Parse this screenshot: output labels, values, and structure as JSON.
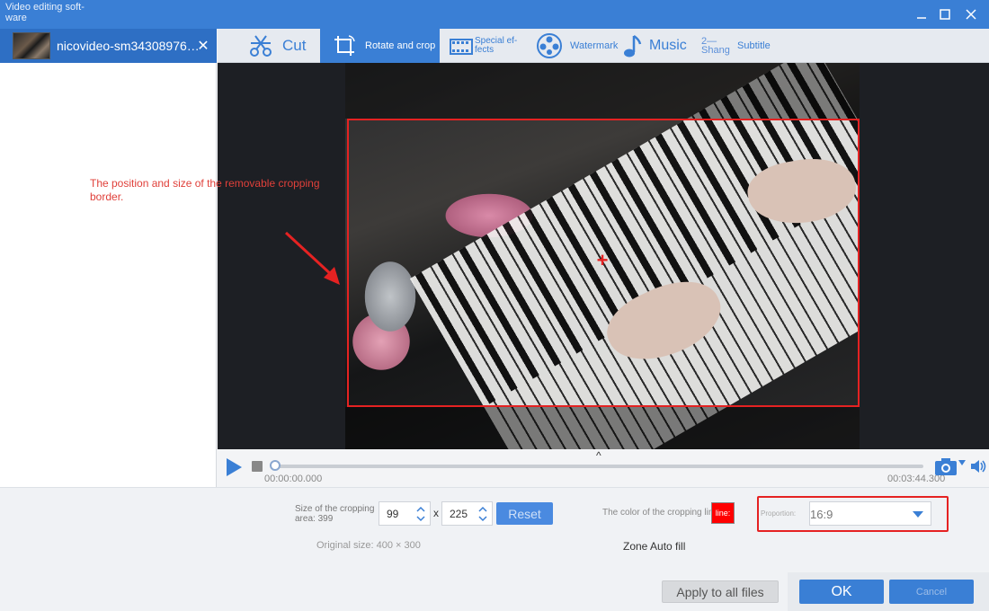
{
  "window": {
    "title": "Video editing soft-ware"
  },
  "file_list": {
    "items": [
      {
        "name": "nicovideo-sm34308976_9..."
      }
    ]
  },
  "toolbar": {
    "tabs": [
      {
        "label": "Cut",
        "icon": "scissors-icon",
        "active": false
      },
      {
        "label": "Rotate and crop",
        "icon": "crop-icon",
        "active": true
      },
      {
        "label": "Special ef-fects",
        "icon": "film-effects-icon",
        "active": false
      },
      {
        "label": "Watermark",
        "icon": "watermark-icon",
        "active": false
      },
      {
        "label": "Music",
        "icon": "music-note-icon",
        "active": false
      },
      {
        "label": "Subtitle",
        "icon_text": "2—\nShang",
        "active": false
      }
    ]
  },
  "preview": {
    "annotation": "The position and size of the removable cropping border.",
    "crop_color": "#e52222"
  },
  "player": {
    "current_time": "00:00:00.000",
    "end_time": "00:03:44.300",
    "progress": 0.0
  },
  "crop_settings": {
    "size_label": "Size of the cropping area: 399",
    "width": "99",
    "height": "225",
    "times_sign": "x",
    "reset_label": "Reset",
    "original_size": "Original size: 400 × 300",
    "line_color_label": "The color of the cropping line:",
    "line_color_swatch_text": "line:",
    "line_color": "#ff0000",
    "zone_label": "Zone Auto fill",
    "proportion_label": "Proportion:",
    "proportion_value": "16:9"
  },
  "footer": {
    "apply_label": "Apply to all files",
    "ok_label": "OK",
    "cancel_label": "Cancel"
  },
  "colors": {
    "accent": "#3a7fd5",
    "highlight": "#e52222"
  }
}
